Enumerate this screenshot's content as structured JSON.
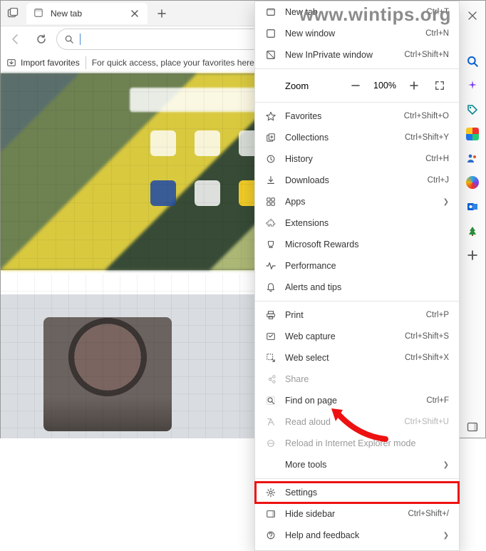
{
  "watermark": "www.wintips.org",
  "tab": {
    "title": "New tab"
  },
  "favorites_bar": {
    "import_label": "Import favorites",
    "message": "For quick access, place your favorites here on the favorites bar."
  },
  "address": {
    "placeholder": "",
    "value": ""
  },
  "menu": {
    "new_tab": {
      "label": "New tab",
      "shortcut": "Ctrl+T"
    },
    "new_window": {
      "label": "New window",
      "shortcut": "Ctrl+N"
    },
    "new_inprivate": {
      "label": "New InPrivate window",
      "shortcut": "Ctrl+Shift+N"
    },
    "zoom": {
      "label": "Zoom",
      "value": "100%"
    },
    "favorites": {
      "label": "Favorites",
      "shortcut": "Ctrl+Shift+O"
    },
    "collections": {
      "label": "Collections",
      "shortcut": "Ctrl+Shift+Y"
    },
    "history": {
      "label": "History",
      "shortcut": "Ctrl+H"
    },
    "downloads": {
      "label": "Downloads",
      "shortcut": "Ctrl+J"
    },
    "apps": {
      "label": "Apps"
    },
    "extensions": {
      "label": "Extensions"
    },
    "rewards": {
      "label": "Microsoft Rewards"
    },
    "performance": {
      "label": "Performance"
    },
    "alerts": {
      "label": "Alerts and tips"
    },
    "print": {
      "label": "Print",
      "shortcut": "Ctrl+P"
    },
    "web_capture": {
      "label": "Web capture",
      "shortcut": "Ctrl+Shift+S"
    },
    "web_select": {
      "label": "Web select",
      "shortcut": "Ctrl+Shift+X"
    },
    "share": {
      "label": "Share"
    },
    "find": {
      "label": "Find on page",
      "shortcut": "Ctrl+F"
    },
    "read_aloud": {
      "label": "Read aloud",
      "shortcut": "Ctrl+Shift+U"
    },
    "ie_mode": {
      "label": "Reload in Internet Explorer mode"
    },
    "more_tools": {
      "label": "More tools"
    },
    "settings": {
      "label": "Settings"
    },
    "hide_sidebar": {
      "label": "Hide sidebar",
      "shortcut": "Ctrl+Shift+/"
    },
    "help": {
      "label": "Help and feedback"
    }
  }
}
